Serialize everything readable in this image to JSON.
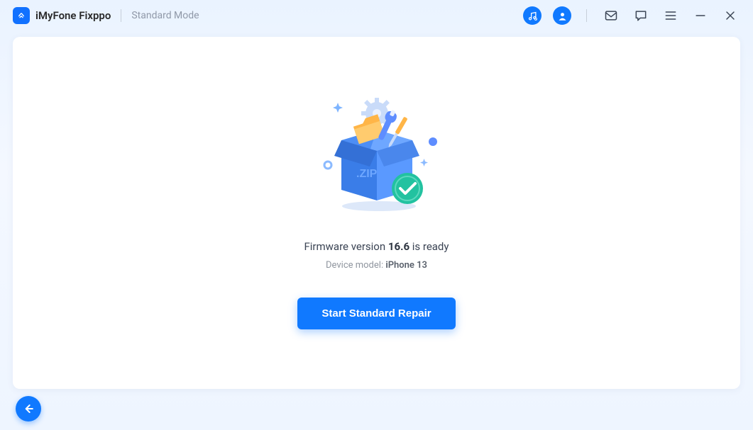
{
  "app": {
    "title": "iMyFone Fixppo"
  },
  "mode": {
    "label": "Standard Mode"
  },
  "main": {
    "status_prefix": "Firmware version ",
    "firmware_version": "16.6",
    "status_suffix": " is ready",
    "device_label": "Device model: ",
    "device_model": "iPhone 13",
    "box_label": ".ZIP"
  },
  "buttons": {
    "primary": "Start Standard Repair"
  }
}
